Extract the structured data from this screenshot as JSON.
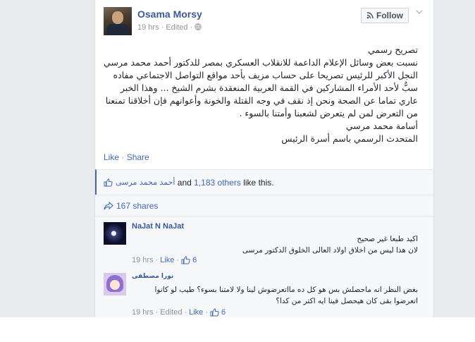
{
  "post": {
    "author": "Osama Morsy",
    "meta": "19 hrs · Edited ·",
    "follow_label": "Follow",
    "paragraphs": [
      "تصريح رسمي",
      "نسبت بعض وسائل الإعلام الداعمة للانقلاب العسكري بمصر للدكتور أحمد محمد مرسي النجل الأكبر للرئيس تصريحا على حساب مزيف بأحد مواقع التواصل الاجتماعي مفاده سبٌّ لأحد الأمراء المشاركين في القمة العربية المنعقدة بشرم الشيخ ... وهذا الخبر عاري تماما عن الصحة ونحن إذ نقف في وجه القتلة والخونة وأعوانهم فإن أخلاقنا تمنعنا من التعرض لمن لم يتعرض لشعبنا وأمتنا بالسوء .",
      "أسامة محمد مرسي",
      "المتحدث الرسمي باسم أسرة الرئيس"
    ],
    "like_label": "Like",
    "share_label": "Share",
    "separator": "·"
  },
  "likes": {
    "arabic_name": "أحمد محمد مرسى",
    "and_text": " and ",
    "others_text": "1,183 others",
    "like_this": " like this."
  },
  "shares": {
    "label": "167 shares"
  },
  "comments": [
    {
      "name": "NaJat N NaJat",
      "lines": [
        "اكيد طبعا غير صحيح",
        "لان هذا ليس من اخلاق اولاد العالى الخلوق الدكتور مرسى"
      ],
      "time": "19 hrs",
      "like_label": "Like",
      "likes_count": "6",
      "separator": "·"
    },
    {
      "name": "نورا مصطفى",
      "lines": [
        "بغض النظر انه ماحصلش بس هو كل ده مااتعرضوش لينا ولا لامتنا بسوء؟ طيب لو كانوا",
        "اتعرضوا بقى كان هيحصل فينا ايه اكتر من كدا؟"
      ],
      "time": "19 hrs",
      "edited": "Edited",
      "like_label": "Like",
      "likes_count": "6",
      "separator": "·"
    }
  ],
  "icons": {
    "globe": "globe-icon",
    "rss": "rss-icon",
    "chevron": "chevron-down-icon",
    "thumb": "thumbs-up-icon",
    "share": "share-arrow-icon"
  },
  "colors": {
    "link": "#3b5998",
    "meta": "#90949c",
    "page_bg": "#e9ebee"
  }
}
